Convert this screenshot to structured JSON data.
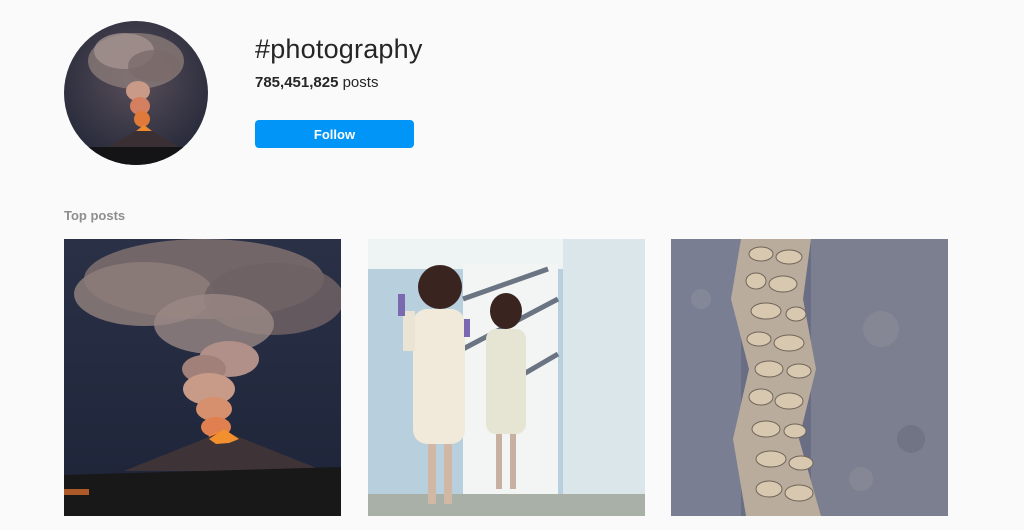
{
  "hashtag": {
    "title": "#photography",
    "post_count": "785,451,825",
    "post_unit": "posts",
    "follow_label": "Follow"
  },
  "sections": {
    "top_posts_label": "Top posts"
  },
  "top_posts": [
    {
      "subject": "erupting volcano at night"
    },
    {
      "subject": "woman in white dress before mirror"
    },
    {
      "subject": "stone wall seam in granite"
    }
  ],
  "colors": {
    "accent": "#0095f6",
    "background": "#fafafa",
    "secondary_text": "#8e8e8e"
  }
}
